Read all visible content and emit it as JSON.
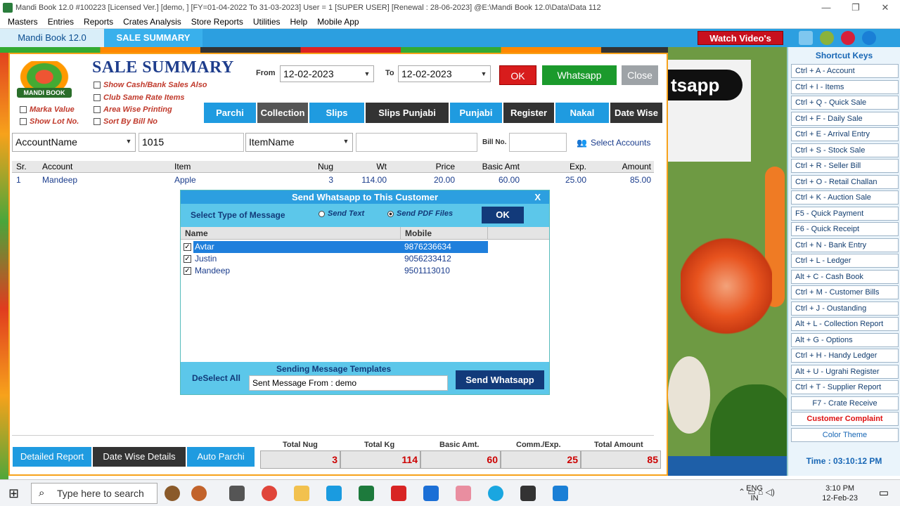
{
  "window": {
    "title": "Mandi Book 12.0 #100223 [Licensed Ver.] [demo, ] [FY=01-04-2022 To 31-03-2023] User = 1 [SUPER USER] [Renewal : 28-06-2023] @E:\\Mandi Book 12.0\\Data\\Data 112",
    "controls": [
      "—",
      "❐",
      "✕"
    ]
  },
  "menu": [
    "Masters",
    "Entries",
    "Reports",
    "Crates Analysis",
    "Store Reports",
    "Utilities",
    "Help",
    "Mobile App"
  ],
  "tabs": {
    "app": "Mandi Book 12.0",
    "active": "SALE SUMMARY",
    "watch": "Watch Video's"
  },
  "header": {
    "title": "SALE SUMMARY",
    "logo_text": "MANDI BOOK",
    "from_label": "From",
    "from_date": "12-02-2023",
    "to_label": "To",
    "to_date": "12-02-2023",
    "ok": "OK",
    "whatsapp": "Whatsapp",
    "close": "Close"
  },
  "options": {
    "show_cash": "Show Cash/Bank Sales Also",
    "club_same": "Club Same Rate Items",
    "area_wise": "Area Wise Printing",
    "sort_bill": "Sort By Bill No",
    "marka": "Marka Value",
    "show_lot": "Show Lot No."
  },
  "report_tabs": [
    "Parchi",
    "Collection",
    "Slips",
    "Slips Punjabi",
    "Punjabi",
    "Register",
    "Nakal",
    "Date Wise"
  ],
  "filter": {
    "account_combo": "AccountName",
    "account_value": "1015",
    "item_combo": "ItemName",
    "item_value": "",
    "bill_label": "Bill No.",
    "bill_value": "",
    "select_accounts": "Select Accounts"
  },
  "grid": {
    "columns": [
      "Sr.",
      "Account",
      "Item",
      "Nug",
      "Wt",
      "Price",
      "Basic Amt",
      "Exp.",
      "Amount"
    ],
    "rows": [
      [
        "1",
        "Mandeep",
        "Apple",
        "3",
        "114.00",
        "20.00",
        "60.00",
        "25.00",
        "85.00"
      ]
    ]
  },
  "bottom": {
    "detailed": "Detailed Report",
    "date_wise": "Date Wise Details",
    "auto_parchi": "Auto Parchi"
  },
  "totals": [
    {
      "label": "Total Nug",
      "value": "3"
    },
    {
      "label": "Total Kg",
      "value": "114"
    },
    {
      "label": "Basic Amt.",
      "value": "60"
    },
    {
      "label": "Comm./Exp.",
      "value": "25"
    },
    {
      "label": "Total Amount",
      "value": "85"
    }
  ],
  "dialog": {
    "title": "Send Whatsapp to This Customer",
    "close": "X",
    "type_label": "Select Type of Message",
    "send_text": "Send Text",
    "send_pdf": "Send PDF Files",
    "ok": "OK",
    "col_name": "Name",
    "col_mobile": "Mobile",
    "contacts": [
      {
        "name": "Avtar",
        "mobile": "9876236634"
      },
      {
        "name": "Justin",
        "mobile": "9056233412"
      },
      {
        "name": "Mandeep",
        "mobile": "9501113010"
      }
    ],
    "deselect": "DeSelect All",
    "templates_label": "Sending Message Templates",
    "template_value": "Sent Message From : demo",
    "send_btn": "Send Whatsapp"
  },
  "side_image_text": "tsapp",
  "shortcuts": {
    "title": "Shortcut Keys",
    "items": [
      "Ctrl + A - Account",
      "Ctrl + I - Items",
      "Ctrl + Q - Quick Sale",
      "Ctrl + F - Daily Sale",
      "Ctrl + E - Arrival Entry",
      "Ctrl + S - Stock Sale",
      "Ctrl + R - Seller Bill",
      "Ctrl + O - Retail Challan",
      "Ctrl + K - Auction Sale",
      "F5 - Quick Payment",
      "F6 - Quick Receipt",
      "Ctrl + N - Bank Entry",
      "Ctrl + L - Ledger",
      "Alt + C - Cash Book",
      "Ctrl + M - Customer Bills",
      "Ctrl + J - Oustanding",
      "Alt + L - Collection Report",
      "Alt + G - Options",
      "Ctrl + H - Handy Ledger",
      "Alt + U - Ugrahi Register",
      "Ctrl + T - Supplier Report"
    ],
    "crate": "F7 - Crate Receive",
    "complaint": "Customer Complaint",
    "color": "Color Theme",
    "time": "Time : 03:10:12 PM"
  },
  "taskbar": {
    "search": "Type here to search",
    "lang1": "ENG",
    "lang2": "IN",
    "clock": "3:10 PM",
    "date": "12-Feb-23"
  }
}
